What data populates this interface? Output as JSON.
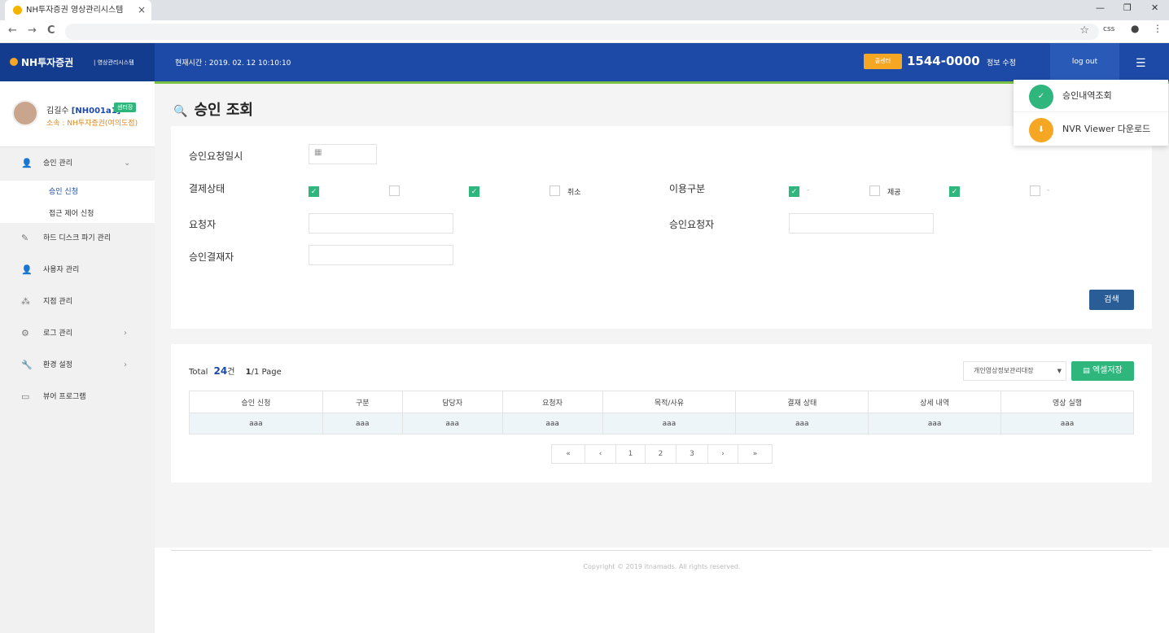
{
  "browser": {
    "tab_title": "NH투자증권 영상관리시스템",
    "close": "×",
    "win_min": "—",
    "win_max": "❐",
    "win_close": "✕",
    "back": "←",
    "forward": "→",
    "reload": "C",
    "star": "☆",
    "ext1": "css",
    "ext2": "●",
    "more": "⋮"
  },
  "header": {
    "logo": "NH투자증권",
    "logo_sub": "| 영상관리시스템",
    "time": "현재시간 : 2019. 02. 12 10:10:10",
    "call_label": "콜센터",
    "phone": "1544-0000",
    "info_edit": "정보 수정",
    "logout": "log out",
    "menu_icon": "☰"
  },
  "profile": {
    "name": "김길수",
    "id": "[NH001a1]",
    "role": "센터장",
    "org": "소속 : NH투자증권(여의도점)"
  },
  "sidebar": {
    "items": [
      {
        "label": "승인 관리",
        "icon": "👤",
        "chev": "⌄"
      },
      {
        "label": "하드 디스크 파기 관리",
        "icon": "✎",
        "chev": ""
      },
      {
        "label": "사용자 관리",
        "icon": "👤",
        "chev": ""
      },
      {
        "label": "지점 관리",
        "icon": "⁂",
        "chev": ""
      },
      {
        "label": "로그 관리",
        "icon": "⚙",
        "chev": "›"
      },
      {
        "label": "환경 설정",
        "icon": "🔧",
        "chev": "›"
      },
      {
        "label": "뷰어 프로그램",
        "icon": "▭",
        "chev": ""
      }
    ],
    "sub_items": [
      "승인 신청",
      "접근 제어 신청"
    ]
  },
  "page": {
    "title": "승인 조회",
    "search_icon": "🔍"
  },
  "form": {
    "date_label": "승인요청일시",
    "calendar_icon": "▦",
    "pay_status_label": "결제상태",
    "cancel_label": "취소",
    "use_type_label": "이용구분",
    "provide_label": "제공",
    "dash": "-",
    "requester_label": "요청자",
    "approve_requester_label": "승인요청자",
    "approver_label": "승인결재자",
    "search_button": "검색",
    "check_mark": "✓"
  },
  "list": {
    "total_label": "Total",
    "total_count": "24",
    "total_unit": "건",
    "page_current": "1",
    "page_info": "/1 Page",
    "select_value": "개인영상정보관리대장",
    "excel_button": "엑셀저장",
    "columns": [
      "승인 신청",
      "구분",
      "담당자",
      "요청자",
      "목적/사유",
      "결재 상태",
      "상세 내역",
      "영상 실행"
    ],
    "row": [
      "aaa",
      "aaa",
      "aaa",
      "aaa",
      "aaa",
      "aaa",
      "aaa",
      "aaa"
    ],
    "pager": [
      "«",
      "‹",
      "1",
      "2",
      "3",
      "›",
      "»"
    ]
  },
  "dropdown": {
    "items": [
      {
        "label": "승인내역조회",
        "icon": "✓",
        "color": "#2eb67d"
      },
      {
        "label": "NVR Viewer 다운로드",
        "icon": "⬇",
        "color": "#f5a623"
      }
    ]
  },
  "footer": {
    "copyright": "Copyright © 2019 itnamads. All rights reserved."
  }
}
